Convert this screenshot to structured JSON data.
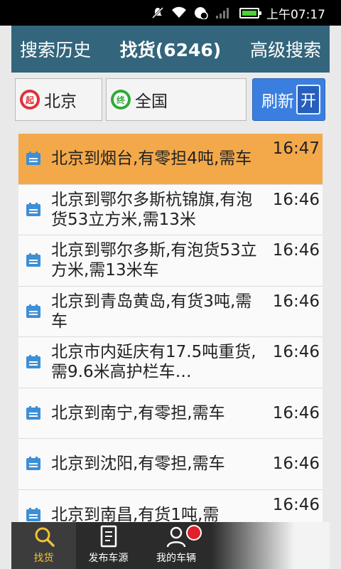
{
  "status_bar": {
    "time": "上午07:17",
    "icons": [
      "mute-icon",
      "wifi-icon",
      "sync-icon",
      "signal-icon",
      "battery-icon"
    ]
  },
  "header": {
    "tabs": [
      {
        "label": "搜索历史",
        "active": false
      },
      {
        "label": "找货(6246)",
        "active": true
      },
      {
        "label": "高级搜索",
        "active": false
      }
    ]
  },
  "search": {
    "from_pin": "起",
    "from_value": "北京",
    "to_pin": "终",
    "to_value": "全国",
    "refresh_label": "刷新",
    "toggle_label": "开"
  },
  "listings": [
    {
      "text": "北京到烟台,有零担4吨,需车",
      "time": "16:47",
      "highlight": true
    },
    {
      "text": "北京到鄂尔多斯杭锦旗,有泡货53立方米,需13米",
      "time": "16:46",
      "highlight": false
    },
    {
      "text": "北京到鄂尔多斯,有泡货53立方米,需13米车",
      "time": "16:46",
      "highlight": false
    },
    {
      "text": "北京到青岛黄岛,有货3吨,需车",
      "time": "16:46",
      "highlight": false
    },
    {
      "text": "北京市内延庆有17.5吨重货,需9.6米高护栏车…",
      "time": "16:46",
      "highlight": false
    },
    {
      "text": "北京到南宁,有零担,需车",
      "time": "16:46",
      "highlight": false
    },
    {
      "text": "北京到沈阳,有零担,需车",
      "time": "16:46",
      "highlight": false
    },
    {
      "text": "北京到南昌,有货1吨,需",
      "time": "16:46",
      "highlight": false
    }
  ],
  "bottom_nav": [
    {
      "label": "找货",
      "icon": "search-icon",
      "active": true
    },
    {
      "label": "发布车源",
      "icon": "document-icon",
      "active": false
    },
    {
      "label": "我的车辆",
      "icon": "user-icon",
      "active": false
    }
  ],
  "colors": {
    "header_bg": "#33657c",
    "highlight_row": "#f3a94a",
    "refresh_button": "#3a7fe0",
    "active_nav_text": "#f1c232"
  }
}
